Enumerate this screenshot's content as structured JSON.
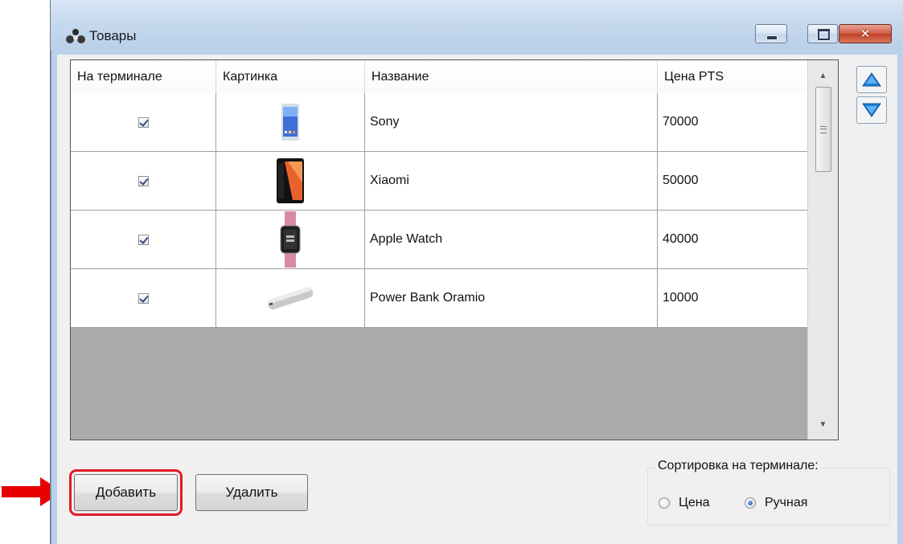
{
  "window": {
    "title": "Товары",
    "buttons": {
      "minimize": "minimize",
      "maximize": "maximize",
      "close": "✕"
    }
  },
  "table": {
    "columns": [
      "На терминале",
      "Картинка",
      "Название",
      "Цена PTS"
    ],
    "rows": [
      {
        "on_terminal": true,
        "image": "sony-phone-image",
        "name": "Sony",
        "price": "70000"
      },
      {
        "on_terminal": true,
        "image": "xiaomi-phone-image",
        "name": "Xiaomi",
        "price": "50000"
      },
      {
        "on_terminal": true,
        "image": "apple-watch-image",
        "name": "Apple Watch",
        "price": "40000"
      },
      {
        "on_terminal": true,
        "image": "power-bank-image",
        "name": "Power Bank Oramio",
        "price": "10000"
      }
    ]
  },
  "actions": {
    "add_label": "Добавить",
    "delete_label": "Удалить"
  },
  "sorting": {
    "title": "Сортировка на терминале:",
    "options": [
      {
        "label": "Цена",
        "selected": false
      },
      {
        "label": "Ручная",
        "selected": true
      }
    ]
  },
  "colors": {
    "highlight": "#e01b24",
    "arrow": "#e60000",
    "move_arrow": "#1e7fd6"
  }
}
